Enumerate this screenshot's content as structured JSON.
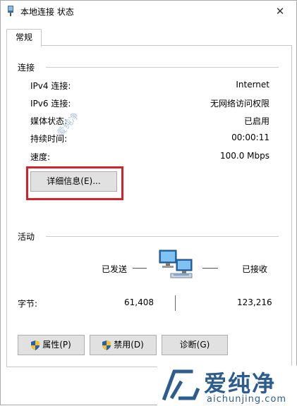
{
  "window": {
    "title": "本地连接 状态",
    "close_glyph": "✕"
  },
  "tabs": [
    {
      "label": "常规"
    }
  ],
  "connection": {
    "title": "连接",
    "rows": [
      {
        "label": "IPv4 连接:",
        "value": "Internet"
      },
      {
        "label": "IPv6 连接:",
        "value": "无网络访问权限"
      },
      {
        "label": "媒体状态:",
        "value": "已启用"
      },
      {
        "label": "持续时间:",
        "value": "00:00:11"
      },
      {
        "label": "速度:",
        "value": "100.0 Mbps"
      }
    ],
    "details_button": "详细信息(E)..."
  },
  "activity": {
    "title": "活动",
    "sent_label": "已发送",
    "received_label": "已接收",
    "bytes_label": "字节:",
    "bytes_sent": "61,408",
    "bytes_received": "123,216",
    "icon": "network-computers-icon"
  },
  "buttons": {
    "properties": "属性(P)",
    "disable": "禁用(D)",
    "diagnose": "诊断(G)"
  },
  "watermark": {
    "brand": "爱纯净",
    "url": "aichunjing.com",
    "side_text": "爱纯净"
  },
  "colors": {
    "highlight": "#d6202a",
    "button_bg": "#e1e1e1",
    "watermark": "#2d5c8e"
  }
}
